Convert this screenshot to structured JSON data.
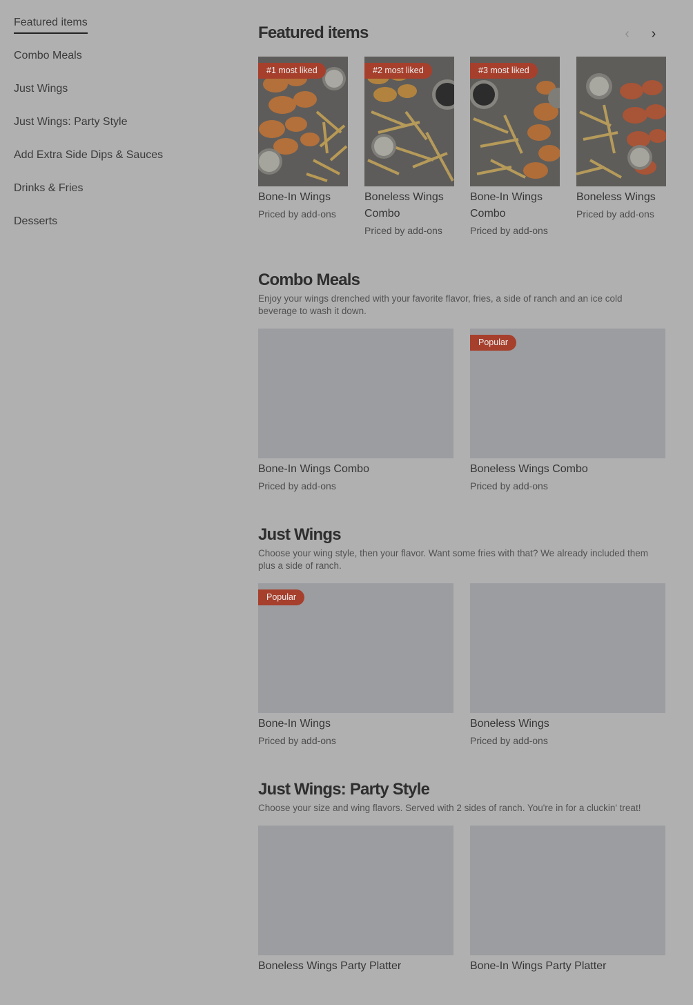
{
  "sidebar": {
    "items": [
      {
        "label": "Featured items"
      },
      {
        "label": "Combo Meals"
      },
      {
        "label": "Just Wings"
      },
      {
        "label": "Just Wings: Party Style"
      },
      {
        "label": "Add Extra Side Dips & Sauces"
      },
      {
        "label": "Drinks & Fries"
      },
      {
        "label": "Desserts"
      }
    ]
  },
  "featured": {
    "title": "Featured items",
    "prev_icon": "chevron-left-icon",
    "next_icon": "chevron-right-icon",
    "items": [
      {
        "badge": "#1 most liked",
        "name": "Bone-In Wings",
        "price": "Priced by add-ons"
      },
      {
        "badge": "#2 most liked",
        "name": "Boneless Wings Combo",
        "price": "Priced by add-ons"
      },
      {
        "badge": "#3 most liked",
        "name": "Bone-In Wings Combo",
        "price": "Priced by add-ons"
      },
      {
        "badge": "",
        "name": "Boneless Wings",
        "price": "Priced by add-ons"
      }
    ]
  },
  "combo": {
    "title": "Combo Meals",
    "description": "Enjoy your wings drenched with your favorite flavor, fries, a side of ranch and an ice cold beverage to wash it down.",
    "items": [
      {
        "badge": "",
        "name": "Bone-In Wings Combo",
        "price": "Priced by add-ons"
      },
      {
        "badge": "Popular",
        "name": "Boneless Wings Combo",
        "price": "Priced by add-ons"
      }
    ]
  },
  "just_wings": {
    "title": "Just Wings",
    "description": "Choose your wing style, then your flavor. Want some fries with that? We already included them plus a side of ranch.",
    "items": [
      {
        "badge": "Popular",
        "name": "Bone-In Wings",
        "price": "Priced by add-ons"
      },
      {
        "badge": "",
        "name": "Boneless Wings",
        "price": "Priced by add-ons"
      }
    ]
  },
  "party": {
    "title": "Just Wings: Party Style",
    "description": "Choose your size and wing flavors. Served with 2 sides of ranch. You're in for a cluckin' treat!",
    "items": [
      {
        "name": "Boneless Wings Party Platter"
      },
      {
        "name": "Bone-In Wings Party Platter"
      }
    ]
  },
  "colors": {
    "overlay": "#b0b0b0",
    "badge": "#a6402d",
    "image_placeholder": "#9b9da1"
  }
}
